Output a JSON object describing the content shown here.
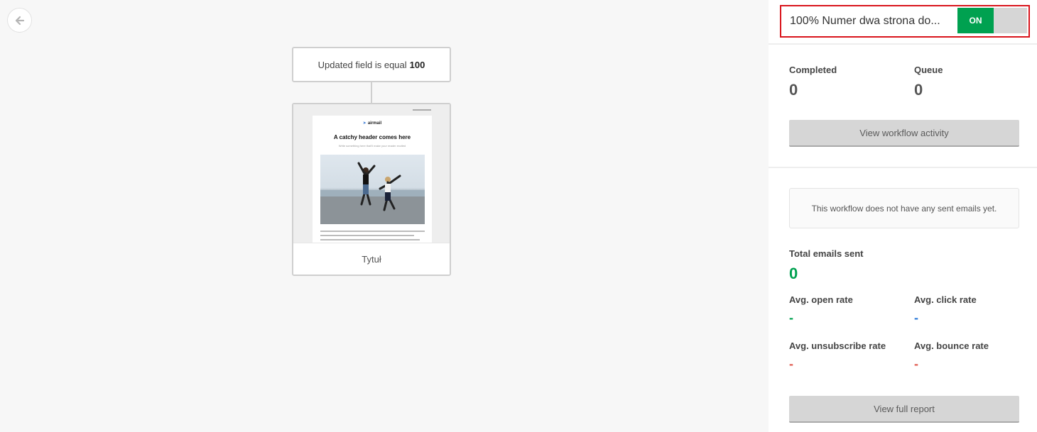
{
  "canvas": {
    "back_icon": "arrow-left-icon",
    "trigger": {
      "text": "Updated field is equal",
      "value": "100"
    },
    "email": {
      "preview_logo": "airmail",
      "preview_header": "A catchy header comes here",
      "preview_subtitle": "Write something here that'll make your reader excited",
      "title": "Tytuł"
    }
  },
  "sidebar": {
    "workflow_name": "100% Numer dwa strona do...",
    "toggle_label": "ON",
    "stats": {
      "completed_label": "Completed",
      "completed_value": "0",
      "queue_label": "Queue",
      "queue_value": "0"
    },
    "view_activity_label": "View workflow activity",
    "empty_message": "This workflow does not have any sent emails yet.",
    "total_sent_label": "Total emails sent",
    "total_sent_value": "0",
    "rates": {
      "open_label": "Avg. open rate",
      "open_value": "-",
      "click_label": "Avg. click rate",
      "click_value": "-",
      "unsubscribe_label": "Avg. unsubscribe rate",
      "unsubscribe_value": "-",
      "bounce_label": "Avg. bounce rate",
      "bounce_value": "-"
    },
    "view_report_label": "View full report"
  },
  "colors": {
    "toggle_on": "#00a150",
    "highlight_border": "#d9141c",
    "total_sent": "#00a150",
    "open_rate": "#00a150",
    "click_rate": "#2f7bd8",
    "unsubscribe_rate": "#e05a4f",
    "bounce_rate": "#e05a4f"
  }
}
